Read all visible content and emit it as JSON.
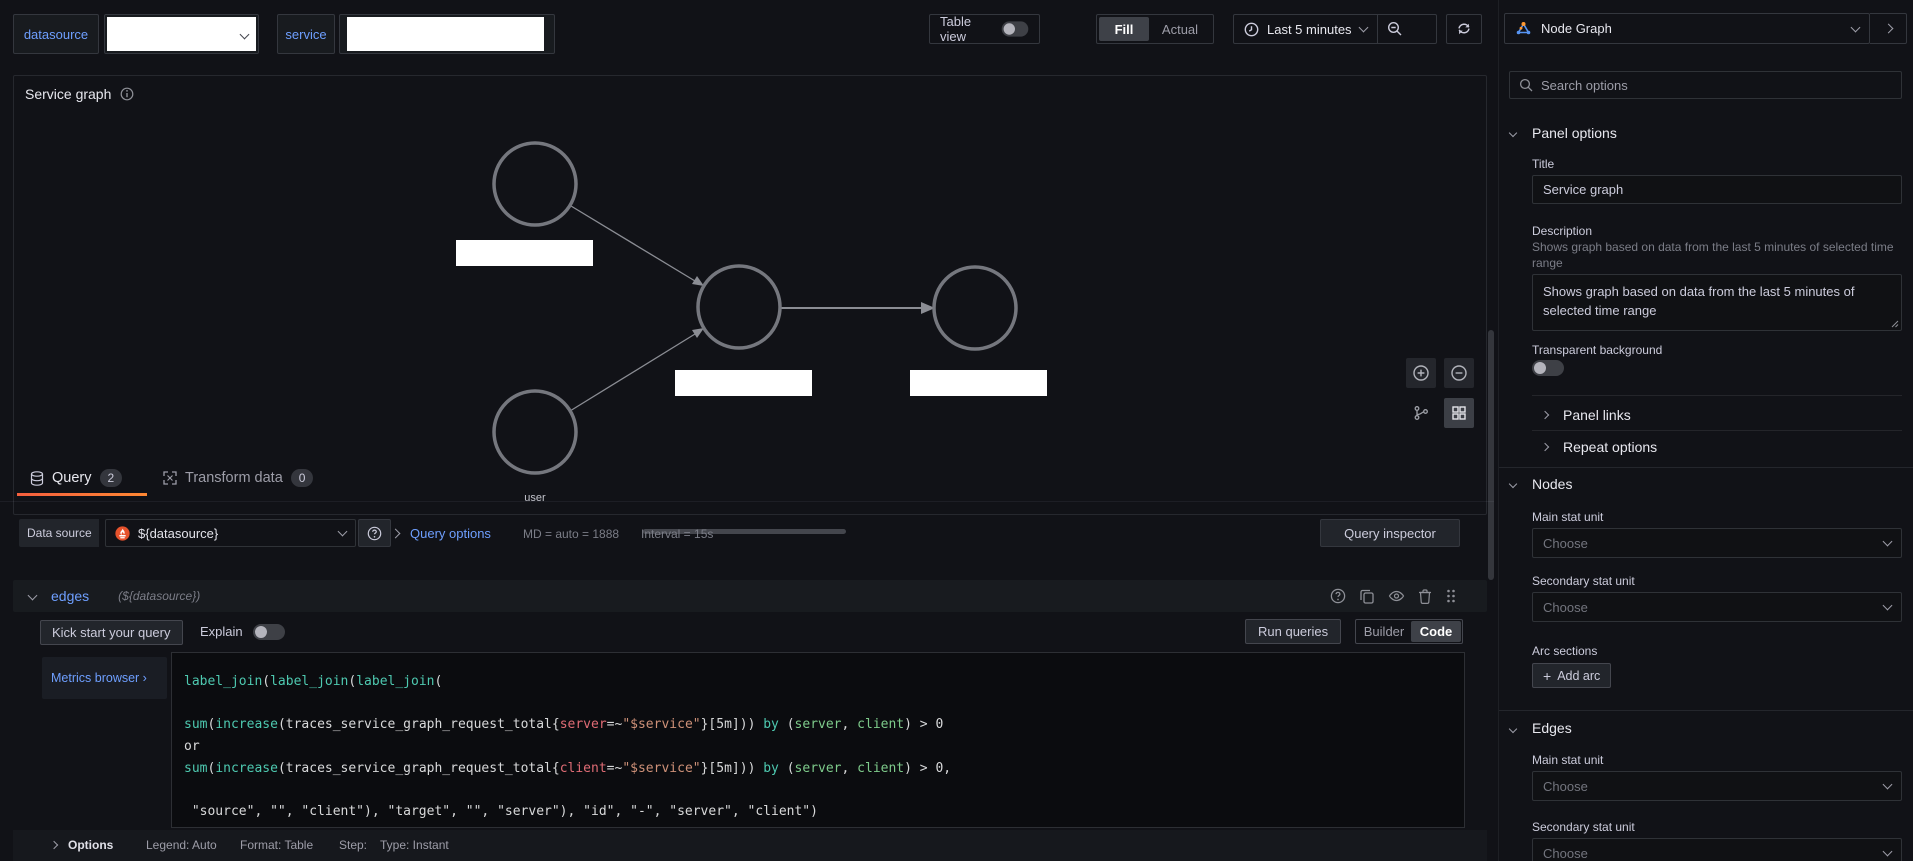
{
  "topbar": {
    "datasource_label": "datasource",
    "service_label": "service",
    "table_view_label": "Table view",
    "fill_label": "Fill",
    "actual_label": "Actual",
    "time_range_label": "Last 5 minutes",
    "panel_type_label": "Node Graph"
  },
  "panel": {
    "title": "Service graph",
    "user_node_label": "user",
    "nodes": [
      {
        "id": "node-1",
        "label_redacted": true
      },
      {
        "id": "node-2",
        "label_redacted": true
      },
      {
        "id": "node-3",
        "label_redacted": true
      },
      {
        "id": "node-user",
        "label": "user"
      }
    ]
  },
  "tabs": {
    "query_label": "Query",
    "query_count": "2",
    "transform_label": "Transform data",
    "transform_count": "0"
  },
  "datasource_row": {
    "label": "Data source",
    "value": "${datasource}",
    "query_options_label": "Query options",
    "md_text": "MD = auto = 1888",
    "interval_text": "Interval = 15s",
    "inspector_label": "Query inspector"
  },
  "query_row": {
    "name": "edges",
    "datasource_ref": "(${datasource})"
  },
  "query_toolbar": {
    "kickstart_label": "Kick start your query",
    "explain_label": "Explain",
    "run_label": "Run queries",
    "builder_label": "Builder",
    "code_label": "Code"
  },
  "editor": {
    "metrics_browser_label": "Metrics browser ›",
    "lines": [
      [
        [
          "fn",
          "label_join"
        ],
        [
          "pl",
          "("
        ],
        [
          "fn",
          "label_join"
        ],
        [
          "pl",
          "("
        ],
        [
          "fn",
          "label_join"
        ],
        [
          "pl",
          "("
        ]
      ],
      [],
      [
        [
          "fn",
          "sum"
        ],
        [
          "pl",
          "("
        ],
        [
          "fn",
          "increase"
        ],
        [
          "pl",
          "("
        ],
        [
          "pl",
          "traces_service_graph_request_total{"
        ],
        [
          "lb",
          "server"
        ],
        [
          "pl",
          "=~"
        ],
        [
          "st",
          "\"$service\""
        ],
        [
          "pl",
          "}[5m])) "
        ],
        [
          "fn",
          "by"
        ],
        [
          "pl",
          " ("
        ],
        [
          "gr",
          "server"
        ],
        [
          "pl",
          ", "
        ],
        [
          "gr",
          "client"
        ],
        [
          "pl",
          ") > 0"
        ]
      ],
      [
        [
          "pl",
          "or"
        ]
      ],
      [
        [
          "fn",
          "sum"
        ],
        [
          "pl",
          "("
        ],
        [
          "fn",
          "increase"
        ],
        [
          "pl",
          "("
        ],
        [
          "pl",
          "traces_service_graph_request_total{"
        ],
        [
          "lb",
          "client"
        ],
        [
          "pl",
          "=~"
        ],
        [
          "st",
          "\"$service\""
        ],
        [
          "pl",
          "}[5m])) "
        ],
        [
          "fn",
          "by"
        ],
        [
          "pl",
          " ("
        ],
        [
          "gr",
          "server"
        ],
        [
          "pl",
          ", "
        ],
        [
          "gr",
          "client"
        ],
        [
          "pl",
          ") > 0,"
        ]
      ],
      [],
      [
        [
          "pl",
          " \"source\", \"\", \"client\"), \"target\", \"\", \"server\"), \"id\", \"-\", \"server\", \"client\")"
        ]
      ]
    ]
  },
  "footer": {
    "options_label": "Options",
    "legend": "Legend: Auto",
    "format": "Format: Table",
    "step": "Step:",
    "type": "Type: Instant"
  },
  "sidebar": {
    "search_placeholder": "Search options",
    "panel_options": {
      "heading": "Panel options",
      "title_label": "Title",
      "title_value": "Service graph",
      "description_label": "Description",
      "description_help": "Shows graph based on data from the last 5 minutes of selected time range",
      "description_value": "Shows graph based on data from the last 5 minutes of selected time range",
      "transparent_label": "Transparent background",
      "panel_links_label": "Panel links",
      "repeat_options_label": "Repeat options"
    },
    "nodes": {
      "heading": "Nodes",
      "main_stat_label": "Main stat unit",
      "main_stat_value": "Choose",
      "secondary_stat_label": "Secondary stat unit",
      "secondary_stat_value": "Choose",
      "arc_sections_label": "Arc sections",
      "add_arc_label": "Add arc"
    },
    "edges": {
      "heading": "Edges",
      "main_stat_label": "Main stat unit",
      "main_stat_value": "Choose",
      "secondary_stat_label": "Secondary stat unit",
      "secondary_stat_value": "Choose"
    }
  },
  "colors": {
    "accent_blue": "#6e9fff",
    "tab_active_orange_start": "#f55f3e",
    "tab_active_orange_end": "#ff8833",
    "prometheus_orange": "#e6522c",
    "node_stroke": "#75777e"
  }
}
